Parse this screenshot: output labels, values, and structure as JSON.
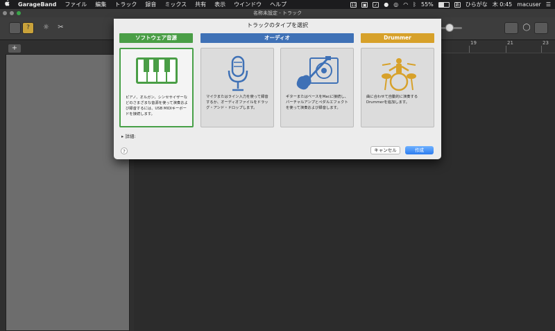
{
  "menubar": {
    "apple": "",
    "app": "GarageBand",
    "items": [
      "ファイル",
      "編集",
      "トラック",
      "録音",
      "ミックス",
      "共有",
      "表示",
      "ウインドウ",
      "ヘルプ"
    ],
    "status": {
      "badge11": "11",
      "battery": "55%",
      "input": "ひらがな",
      "clock": "木 0:45",
      "user": "macuser"
    }
  },
  "window": {
    "title": "名称未設定 - トラック"
  },
  "leftpanel": {
    "add_label": "+"
  },
  "ruler": {
    "ticks": [
      "19",
      "21",
      "23"
    ]
  },
  "dialog": {
    "title": "トラックのタイプを選択",
    "categories": {
      "software": "ソフトウェア音源",
      "audio": "オーディオ",
      "drummer": "Drummer"
    },
    "cards": [
      {
        "desc": "ピアノ、オルガン、シンセサイザーなどのさまざまな音源を使って演奏および録音するには、USB MIDIキーボードを接続します。"
      },
      {
        "desc": "マイクまたはライン入力を使って録音するか、オーディオファイルをドラッグ・アンド・ドロップします。"
      },
      {
        "desc": "ギターまたはベースをMacに接続し、バーチャルアンプとペダルエフェクトを使って演奏および録音します。"
      },
      {
        "desc": "曲に合わせて自動的に演奏するDrummerを追加します。"
      }
    ],
    "details": "▸ 詳細:",
    "help": "?",
    "cancel": "キャンセル",
    "create": "作成"
  },
  "colors": {
    "software": "#4a9e46",
    "audio": "#3f71b6",
    "drummer": "#d7a12a",
    "select": "#47a047"
  }
}
